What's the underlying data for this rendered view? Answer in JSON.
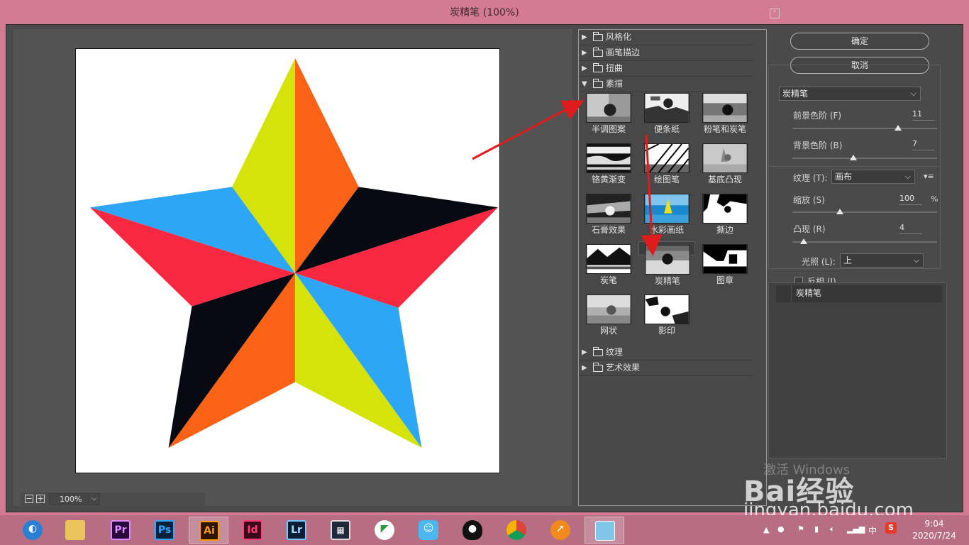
{
  "window": {
    "title": "炭精笔 (100%)"
  },
  "preview": {
    "zoom_value": "100%",
    "zoom_out_icon": "minus-box-icon",
    "zoom_in_icon": "plus-box-icon"
  },
  "gallery": {
    "categories_top": [
      {
        "label": "风格化",
        "expanded": false
      },
      {
        "label": "画笔描边",
        "expanded": false
      },
      {
        "label": "扭曲",
        "expanded": false
      },
      {
        "label": "素描",
        "expanded": true
      }
    ],
    "sketch_filters": [
      {
        "label": "半调图案"
      },
      {
        "label": "便条纸"
      },
      {
        "label": "粉笔和炭笔"
      },
      {
        "label": "铬黄渐变"
      },
      {
        "label": "绘图笔"
      },
      {
        "label": "基底凸现"
      },
      {
        "label": "石膏效果"
      },
      {
        "label": "水彩画纸"
      },
      {
        "label": "撕边"
      },
      {
        "label": "炭笔"
      },
      {
        "label": "炭精笔",
        "selected": true
      },
      {
        "label": "图章"
      },
      {
        "label": "网状"
      },
      {
        "label": "影印"
      }
    ],
    "categories_bottom": [
      {
        "label": "纹理",
        "expanded": false
      },
      {
        "label": "艺术效果",
        "expanded": false
      }
    ]
  },
  "buttons": {
    "ok": "确定",
    "cancel": "取消"
  },
  "settings": {
    "filter_select": "炭精笔",
    "foreground_label": "前景色阶 (F)",
    "foreground_value": "11",
    "foreground_fraction": 0.73,
    "background_label": "背景色阶 (B)",
    "background_value": "7",
    "background_fraction": 0.42,
    "texture_label": "纹理 (T):",
    "texture_value": "画布",
    "scale_label": "缩放 (S)",
    "scale_value": "100",
    "scale_unit": "%",
    "scale_fraction": 0.33,
    "relief_label": "凸现 (R)",
    "relief_value": "4",
    "relief_fraction": 0.08,
    "light_label": "光照 (L):",
    "light_value": "上",
    "invert_label": "反相 (I)",
    "invert_checked": false
  },
  "layers": {
    "items": [
      {
        "name": "炭精笔"
      }
    ]
  },
  "watermark": {
    "line1": "激活 Windows",
    "brand": "Bai经验",
    "url": "jingyan.baidu.com"
  },
  "taskbar": {
    "apps": [
      {
        "name": "browser",
        "label": ""
      },
      {
        "name": "file-explorer",
        "label": ""
      },
      {
        "name": "premiere",
        "label": "Pr"
      },
      {
        "name": "photoshop",
        "label": "Ps"
      },
      {
        "name": "illustrator",
        "label": "Ai",
        "active": true
      },
      {
        "name": "indesign",
        "label": "Id"
      },
      {
        "name": "lightroom",
        "label": "Lr"
      },
      {
        "name": "video-editor",
        "label": ""
      },
      {
        "name": "media-app",
        "label": ""
      },
      {
        "name": "chat-app",
        "label": ""
      },
      {
        "name": "qq",
        "label": ""
      },
      {
        "name": "chrome",
        "label": ""
      },
      {
        "name": "fox-app",
        "label": ""
      },
      {
        "name": "notes",
        "label": ""
      }
    ],
    "tray_ime": "中",
    "time": "9:04",
    "date": "2020/7/24"
  },
  "colors": {
    "accent": "#d57a93",
    "dialog": "#4a4a4a",
    "arrow": "#e01b1b"
  }
}
